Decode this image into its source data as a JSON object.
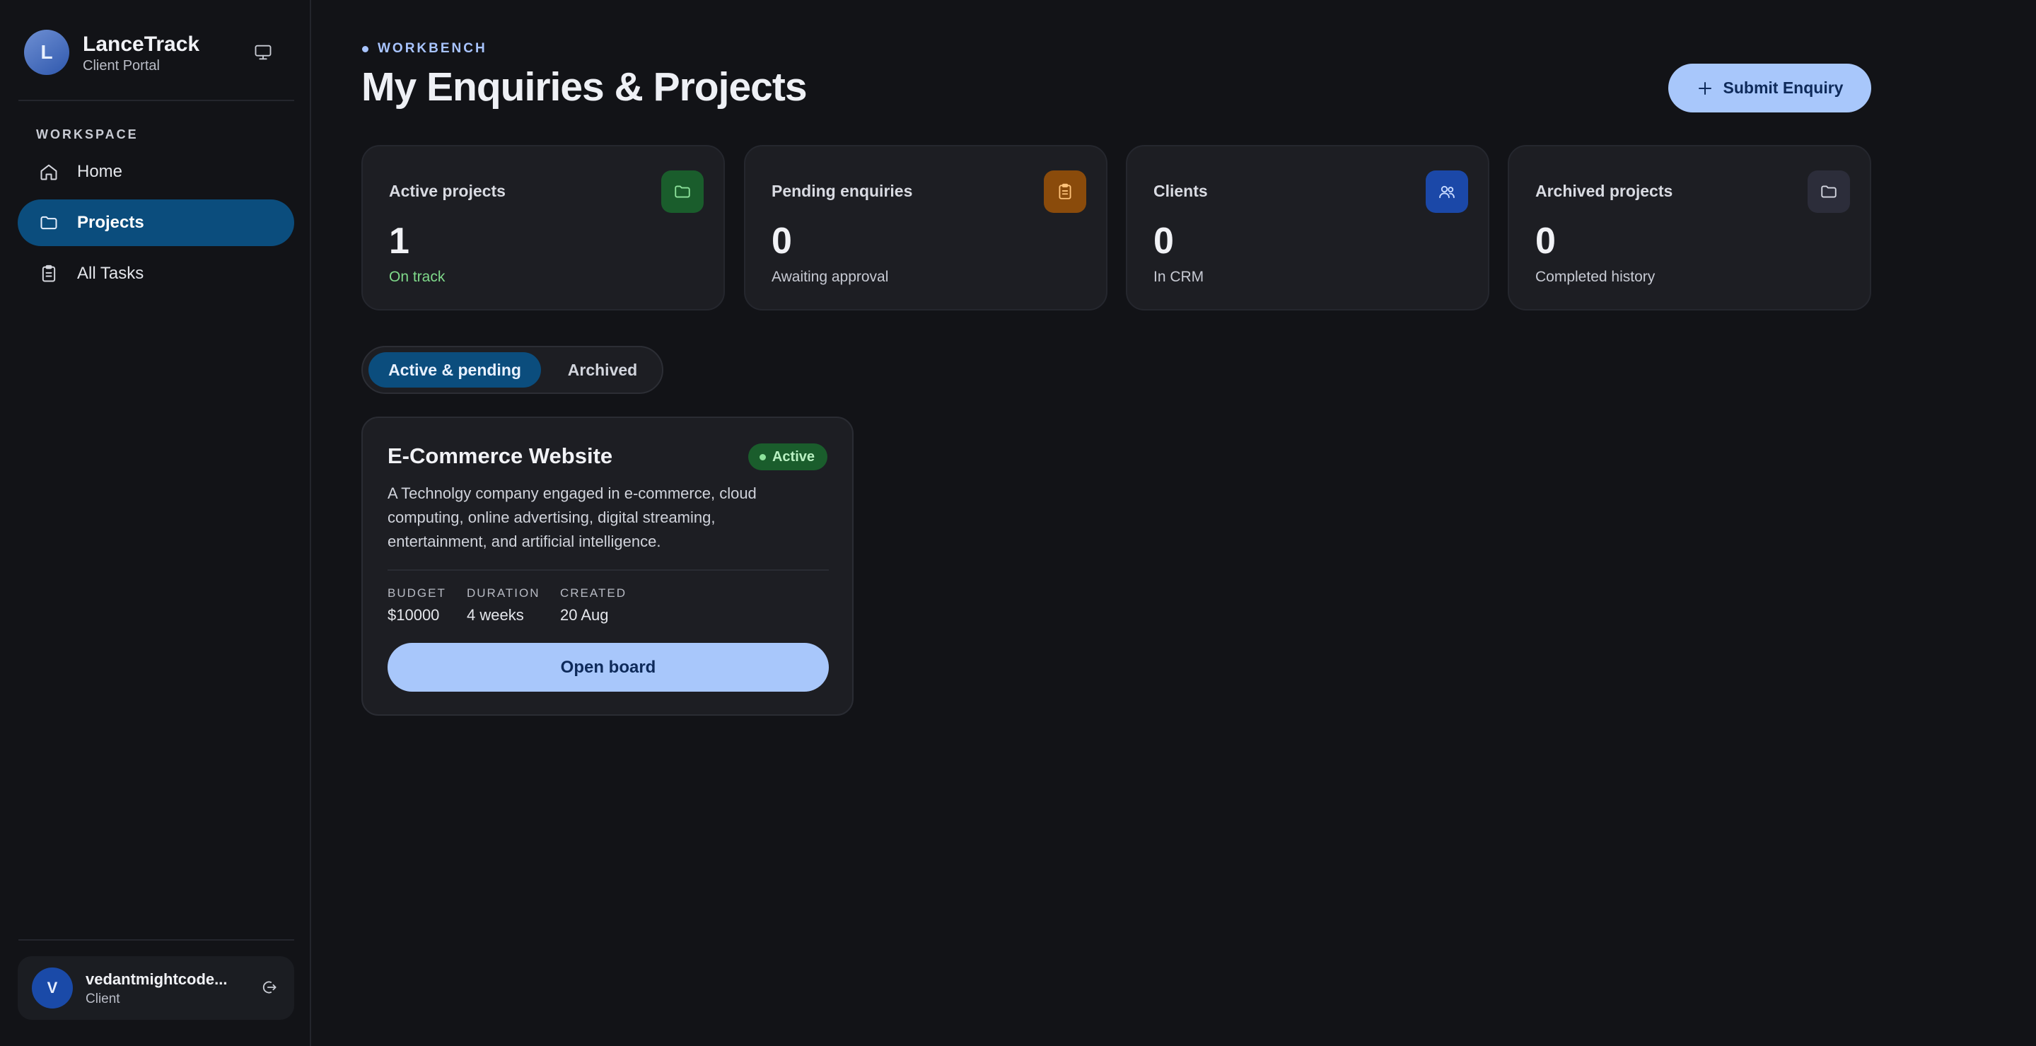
{
  "brand": {
    "initial": "L",
    "name": "LanceTrack",
    "subtitle": "Client Portal",
    "monitor_icon": "monitor-icon"
  },
  "sidebar": {
    "section_label": "WORKSPACE",
    "items": [
      {
        "label": "Home",
        "icon": "home-icon"
      },
      {
        "label": "Projects",
        "icon": "folder-icon",
        "active": true
      },
      {
        "label": "All Tasks",
        "icon": "clipboard-icon"
      }
    ]
  },
  "user": {
    "initial": "V",
    "name": "vedantmightcode...",
    "role": "Client",
    "logout_icon": "logout-icon"
  },
  "header": {
    "eyebrow": "WORKBENCH",
    "title": "My Enquiries & Projects",
    "submit_label": "Submit Enquiry"
  },
  "stats": [
    {
      "title": "Active projects",
      "value": "1",
      "sub": "On track",
      "icon": "folder-icon",
      "color": "#1a5d2c"
    },
    {
      "title": "Pending enquiries",
      "value": "0",
      "sub": "Awaiting approval",
      "icon": "clipboard-icon",
      "color": "#8a4b0b"
    },
    {
      "title": "Clients",
      "value": "0",
      "sub": "In CRM",
      "icon": "users-icon",
      "color": "#1b48a8"
    },
    {
      "title": "Archived projects",
      "value": "0",
      "sub": "Completed history",
      "icon": "folder-icon",
      "color": "#2c2d3a"
    }
  ],
  "tabs": [
    {
      "label": "Active & pending",
      "active": true
    },
    {
      "label": "Archived",
      "active": false
    }
  ],
  "project": {
    "title": "E-Commerce Website",
    "status": "Active",
    "description": "A Technolgy company engaged in e-commerce, cloud computing, online advertising, digital streaming, entertainment, and artificial intelligence.",
    "meta": [
      {
        "key": "BUDGET",
        "value": "$10000"
      },
      {
        "key": "DURATION",
        "value": "4 weeks"
      },
      {
        "key": "CREATED",
        "value": "20 Aug"
      }
    ],
    "open_label": "Open board"
  },
  "colors": {
    "accent": "#a8c7fb",
    "active_nav": "#0b4d7d",
    "background": "#121317",
    "card": "#1d1e23"
  }
}
